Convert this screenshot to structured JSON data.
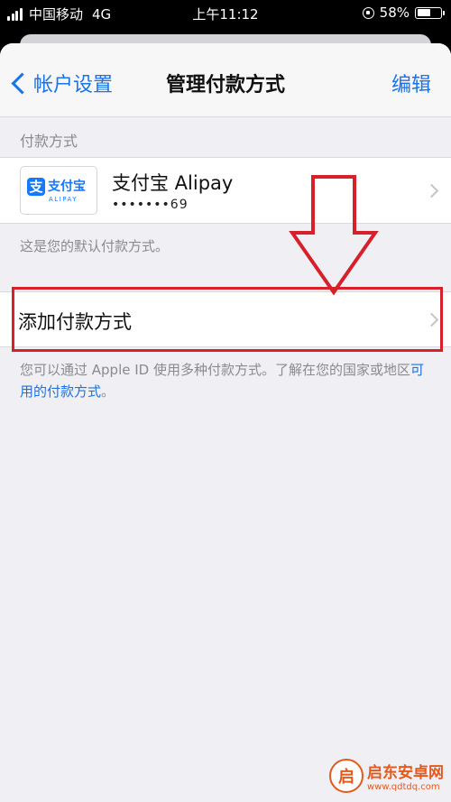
{
  "status_bar": {
    "carrier": "中国移动",
    "network": "4G",
    "time": "上午11:12",
    "battery": "58%",
    "battery_level": 0.58
  },
  "nav": {
    "back_label": "帐户设置",
    "title": "管理付款方式",
    "edit_label": "编辑"
  },
  "payment_section": {
    "header": "付款方式",
    "method": {
      "logo_text": "支付宝",
      "logo_mark": "支",
      "logo_subtext": "ALIPAY",
      "name": "支付宝 Alipay",
      "masked_account": "•••••••69"
    },
    "default_note": "这是您的默认付款方式。"
  },
  "add_method": {
    "label": "添加付款方式"
  },
  "info": {
    "text": "您可以通过 Apple ID 使用多种付款方式。了解在您的国家或地区",
    "link": "可用的付款方式",
    "end": "。"
  },
  "annotation": {
    "arrow_color": "#d6202a",
    "box_color": "#d6202a"
  },
  "watermark": {
    "logo": "启",
    "name": "启东安卓网",
    "url": "www.qdtdq.com"
  },
  "colors": {
    "accent": "#1a73e8",
    "alipay_blue": "#1677ff"
  }
}
